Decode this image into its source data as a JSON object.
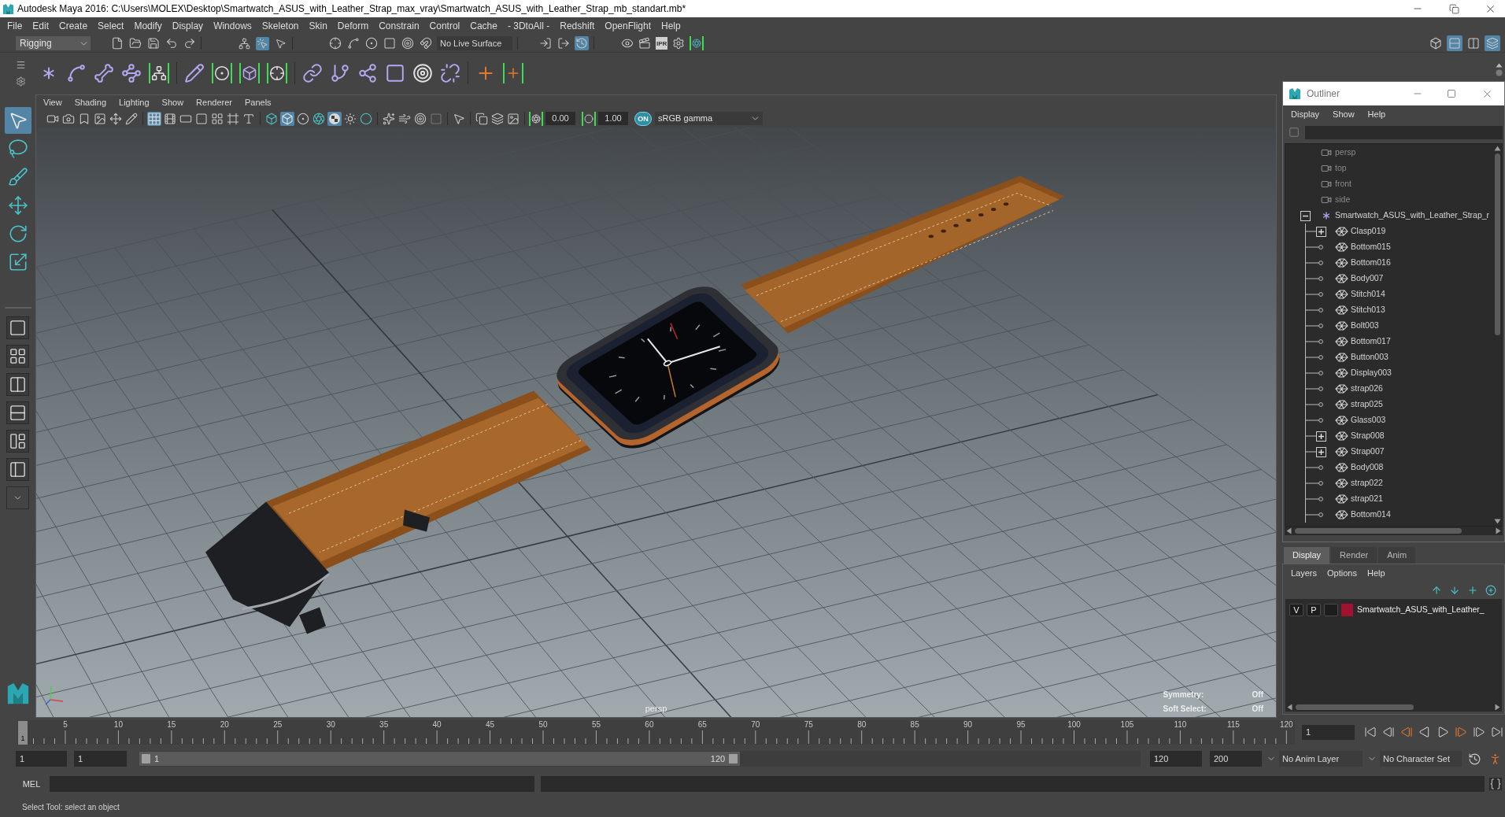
{
  "window": {
    "title": "Autodesk Maya 2016: C:\\Users\\MOLEX\\Desktop\\Smartwatch_ASUS_with_Leather_Strap_max_vray\\Smartwatch_ASUS_with_Leather_Strap_mb_standart.mb*"
  },
  "menu_bar": [
    "File",
    "Edit",
    "Create",
    "Select",
    "Modify",
    "Display",
    "Windows",
    "Skeleton",
    "Skin",
    "Deform",
    "Constrain",
    "Control",
    "Cache",
    "- 3DtoAll -",
    "Redshift",
    "OpenFlight",
    "Help"
  ],
  "status_line": {
    "menu_set": "Rigging",
    "selection_modes": [
      {
        "selected": false
      },
      {
        "selected": true
      },
      {
        "selected": false
      }
    ],
    "live_surface": "No Live Surface",
    "history_toggles": [
      {
        "on": false
      },
      {
        "on": false
      },
      {
        "on": true
      }
    ],
    "render_ipr": "IPR",
    "panel_toggles": [
      {
        "on": false
      },
      {
        "on": true
      },
      {
        "on": false
      },
      {
        "on": true
      }
    ]
  },
  "toolbox": {
    "tools": [
      {
        "selected": true
      },
      {
        "selected": false
      },
      {
        "selected": false
      },
      {
        "selected": false
      },
      {
        "selected": false
      },
      {
        "selected": false
      }
    ]
  },
  "viewport": {
    "menus": [
      "View",
      "Shading",
      "Lighting",
      "Show",
      "Renderer",
      "Panels"
    ],
    "toolbar": {
      "buttons": [
        {
          "on": false
        },
        {
          "on": false
        },
        {
          "on": false
        },
        {
          "on": false
        },
        {
          "on": false
        },
        {
          "on": false
        },
        {
          "on": true
        },
        {
          "on": false
        },
        {
          "on": false
        },
        {
          "on": false
        },
        {
          "on": false
        },
        {
          "on": false
        },
        {
          "on": false
        },
        {
          "on": false
        },
        {
          "on": true
        },
        {
          "on": false
        },
        {
          "on": false
        },
        {
          "on": true
        },
        {
          "on": false
        },
        {
          "on": false
        },
        {
          "on": false
        },
        {
          "on": false
        },
        {
          "on": false
        },
        {
          "on": false
        },
        {
          "on": false
        },
        {
          "on": false
        },
        {
          "on": false
        },
        {
          "on": false
        }
      ],
      "exposure": "0.00",
      "gamma": "1.00",
      "color_management": "ON",
      "color_space": "sRGB gamma"
    },
    "camera": "persp",
    "hud": [
      {
        "label": "Symmetry:",
        "value": "Off"
      },
      {
        "label": "Soft Select:",
        "value": "Off"
      }
    ]
  },
  "outliner": {
    "title": "Outliner",
    "menus": [
      "Display",
      "Show",
      "Help"
    ],
    "items": [
      {
        "label": "persp",
        "kind": "camera",
        "hidden": true
      },
      {
        "label": "top",
        "kind": "camera",
        "hidden": true
      },
      {
        "label": "front",
        "kind": "camera",
        "hidden": true
      },
      {
        "label": "side",
        "kind": "camera",
        "hidden": true
      },
      {
        "label": "Smartwatch_ASUS_with_Leather_Strap_r",
        "kind": "group",
        "hidden": false,
        "expanded": true,
        "children": [
          {
            "label": "Clasp019",
            "kind": "mesh",
            "hidden": false,
            "expanded": false
          },
          {
            "label": "Bottom015",
            "kind": "mesh",
            "hidden": false
          },
          {
            "label": "Bottom016",
            "kind": "mesh",
            "hidden": false
          },
          {
            "label": "Body007",
            "kind": "mesh",
            "hidden": false
          },
          {
            "label": "Stitch014",
            "kind": "mesh",
            "hidden": false
          },
          {
            "label": "Stitch013",
            "kind": "mesh",
            "hidden": false
          },
          {
            "label": "Bolt003",
            "kind": "mesh",
            "hidden": false
          },
          {
            "label": "Bottom017",
            "kind": "mesh",
            "hidden": false
          },
          {
            "label": "Button003",
            "kind": "mesh",
            "hidden": false
          },
          {
            "label": "Display003",
            "kind": "mesh",
            "hidden": false
          },
          {
            "label": "strap026",
            "kind": "mesh",
            "hidden": false
          },
          {
            "label": "strap025",
            "kind": "mesh",
            "hidden": false
          },
          {
            "label": "Glass003",
            "kind": "mesh",
            "hidden": false
          },
          {
            "label": "Strap008",
            "kind": "mesh",
            "hidden": false,
            "expanded": false
          },
          {
            "label": "Strap007",
            "kind": "mesh",
            "hidden": false,
            "expanded": false
          },
          {
            "label": "Body008",
            "kind": "mesh",
            "hidden": false
          },
          {
            "label": "strap022",
            "kind": "mesh",
            "hidden": false
          },
          {
            "label": "strap021",
            "kind": "mesh",
            "hidden": false
          },
          {
            "label": "Bottom014",
            "kind": "mesh",
            "hidden": false
          }
        ]
      }
    ]
  },
  "layer_editor": {
    "tabs": [
      {
        "label": "Display",
        "selected": true
      },
      {
        "label": "Render",
        "selected": false
      },
      {
        "label": "Anim",
        "selected": false
      }
    ],
    "menus": [
      "Layers",
      "Options",
      "Help"
    ],
    "layers": [
      {
        "visibility": "V",
        "playback": "P",
        "color": "#a1122e",
        "name": "Smartwatch_ASUS_with_Leather_"
      }
    ]
  },
  "time_slider": {
    "ticks": [
      "5",
      "10",
      "15",
      "20",
      "25",
      "30",
      "35",
      "40",
      "45",
      "50",
      "55",
      "60",
      "65",
      "70",
      "75",
      "80",
      "85",
      "90",
      "95",
      "100",
      "105",
      "110",
      "115",
      "120"
    ],
    "current_frame": "1",
    "level": 0,
    "current_frame_field": "1"
  },
  "range_slider": {
    "animation_start": "1",
    "playback_start": "1",
    "level": 0.6,
    "range_start": "1",
    "range_end": "120",
    "playback_end": "120",
    "animation_end": "200",
    "anim_layer": "No Anim Layer",
    "character_set": "No Character Set"
  },
  "command_line": {
    "language": "MEL"
  },
  "help_line": "Select Tool: select an object"
}
